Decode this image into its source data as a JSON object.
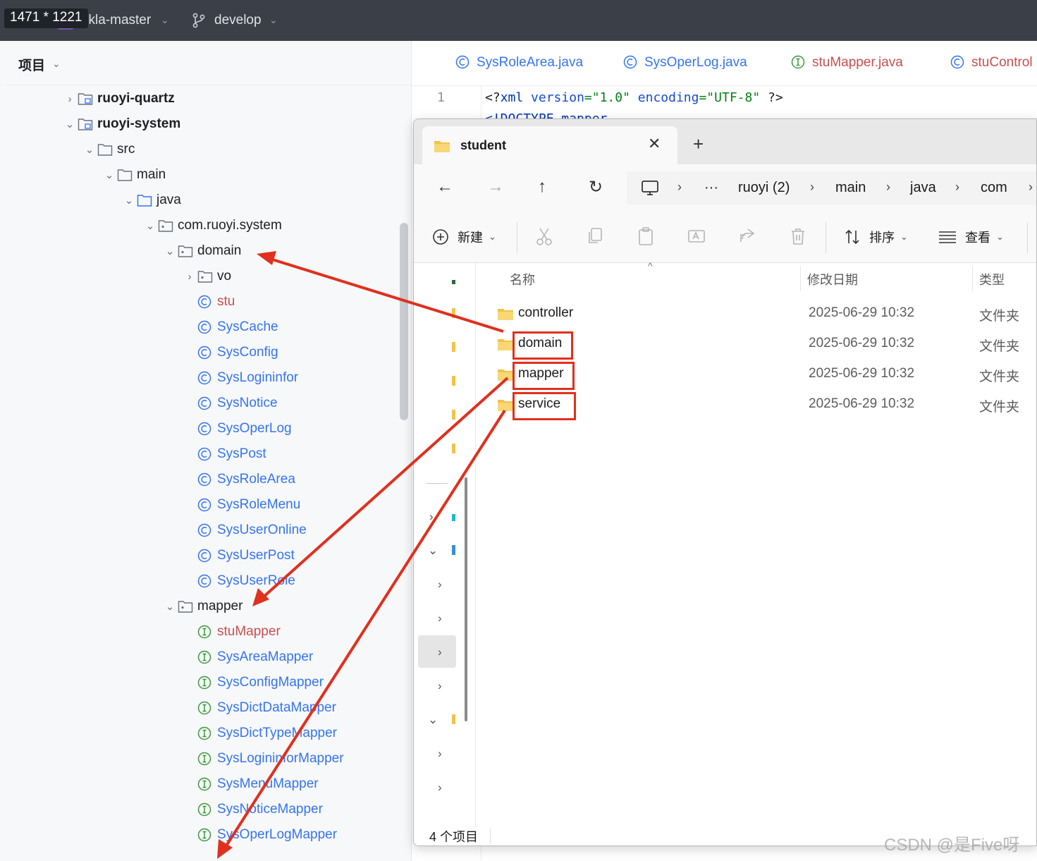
{
  "overlay": {
    "size_label": "1471 * 1221"
  },
  "topbar": {
    "project_name": "zkla-master",
    "branch": "develop"
  },
  "project_panel": {
    "title": "项目",
    "tree": [
      {
        "label": "ruoyi-quartz",
        "kind": "module",
        "bold": true,
        "expanded": false,
        "depth": 0
      },
      {
        "label": "ruoyi-system",
        "kind": "module",
        "bold": true,
        "expanded": true,
        "depth": 0
      },
      {
        "label": "src",
        "kind": "folder",
        "expanded": true,
        "depth": 1
      },
      {
        "label": "main",
        "kind": "folder",
        "expanded": true,
        "depth": 2
      },
      {
        "label": "java",
        "kind": "source",
        "expanded": true,
        "depth": 3
      },
      {
        "label": "com.ruoyi.system",
        "kind": "package",
        "expanded": true,
        "depth": 4
      },
      {
        "label": "domain",
        "kind": "package",
        "expanded": true,
        "depth": 5
      },
      {
        "label": "vo",
        "kind": "package",
        "expanded": false,
        "depth": 6
      },
      {
        "label": "stu",
        "kind": "class",
        "modified": true,
        "depth": 6
      },
      {
        "label": "SysCache",
        "kind": "class",
        "depth": 6
      },
      {
        "label": "SysConfig",
        "kind": "class",
        "depth": 6
      },
      {
        "label": "SysLogininfor",
        "kind": "class",
        "depth": 6
      },
      {
        "label": "SysNotice",
        "kind": "class",
        "depth": 6
      },
      {
        "label": "SysOperLog",
        "kind": "class",
        "depth": 6
      },
      {
        "label": "SysPost",
        "kind": "class",
        "depth": 6
      },
      {
        "label": "SysRoleArea",
        "kind": "class",
        "depth": 6
      },
      {
        "label": "SysRoleMenu",
        "kind": "class",
        "depth": 6
      },
      {
        "label": "SysUserOnline",
        "kind": "class",
        "depth": 6
      },
      {
        "label": "SysUserPost",
        "kind": "class",
        "depth": 6
      },
      {
        "label": "SysUserRole",
        "kind": "class",
        "depth": 6
      },
      {
        "label": "mapper",
        "kind": "package",
        "expanded": true,
        "depth": 5
      },
      {
        "label": "stuMapper",
        "kind": "interface",
        "modified": true,
        "depth": 6
      },
      {
        "label": "SysAreaMapper",
        "kind": "interface",
        "depth": 6
      },
      {
        "label": "SysConfigMapper",
        "kind": "interface",
        "depth": 6
      },
      {
        "label": "SysDictDataMapper",
        "kind": "interface",
        "depth": 6
      },
      {
        "label": "SysDictTypeMapper",
        "kind": "interface",
        "depth": 6
      },
      {
        "label": "SysLogininforMapper",
        "kind": "interface",
        "depth": 6
      },
      {
        "label": "SysMenuMapper",
        "kind": "interface",
        "depth": 6
      },
      {
        "label": "SysNoticeMapper",
        "kind": "interface",
        "depth": 6
      },
      {
        "label": "SysOperLogMapper",
        "kind": "interface",
        "depth": 6
      }
    ]
  },
  "editor": {
    "tabs": [
      {
        "label": "SysRoleArea.java",
        "kind": "class"
      },
      {
        "label": "SysOperLog.java",
        "kind": "class"
      },
      {
        "label": "stuMapper.java",
        "kind": "interface",
        "modified": true
      },
      {
        "label": "stuControl",
        "kind": "class",
        "modified": true
      }
    ],
    "line_number": "1",
    "code_parts": [
      "<?",
      "xml ",
      "version",
      "=\"1.0\" ",
      "encoding",
      "=\"UTF-8\" ",
      "?>"
    ],
    "code_line2": "<!DOCTYPE mapper"
  },
  "explorer": {
    "tab_title": "student",
    "close_glyph": "✕",
    "new_tab_glyph": "+",
    "nav": {
      "back": "←",
      "forward": "→",
      "up": "↑",
      "refresh": "↻",
      "more": "···",
      "sep": "›"
    },
    "breadcrumb": [
      "ruoyi (2)",
      "main",
      "java",
      "com"
    ],
    "toolbar": {
      "new_label": "新建",
      "sort_label": "排序",
      "view_label": "查看",
      "dropdown": "⌄"
    },
    "columns": {
      "name": "名称",
      "modified": "修改日期",
      "type": "类型",
      "sort_glyph": "^"
    },
    "files": [
      {
        "name": "controller",
        "date": "2025-06-29 10:32",
        "type": "文件夹",
        "highlighted": false
      },
      {
        "name": "domain",
        "date": "2025-06-29 10:32",
        "type": "文件夹",
        "highlighted": true
      },
      {
        "name": "mapper",
        "date": "2025-06-29 10:32",
        "type": "文件夹",
        "highlighted": true
      },
      {
        "name": "service",
        "date": "2025-06-29 10:32",
        "type": "文件夹",
        "highlighted": true
      }
    ],
    "status": "4 个项目"
  },
  "watermark": "CSDN @是Five呀",
  "colors": {
    "arrow": "#e0301e",
    "class_icon": "#3574f0",
    "interface_icon": "#3c9a3c",
    "modified": "#c94f4f",
    "folder": "#f2c24b"
  }
}
